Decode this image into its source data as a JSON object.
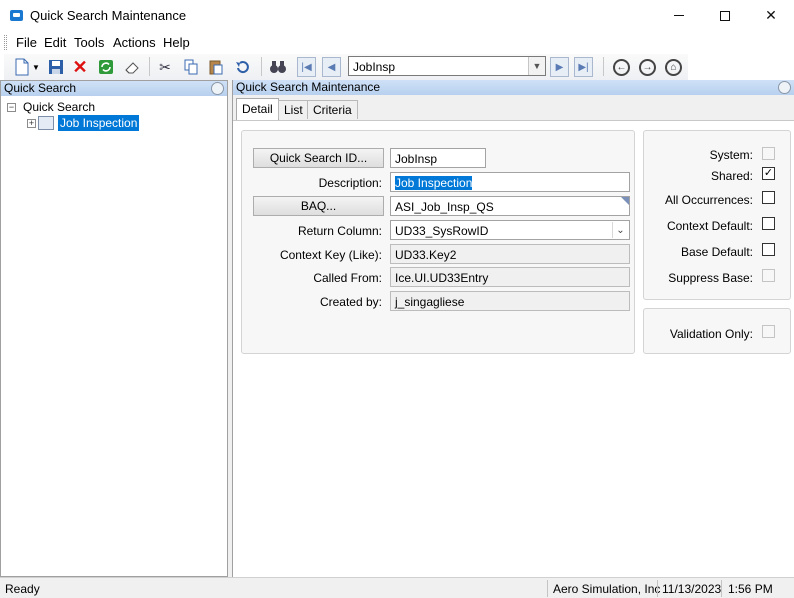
{
  "window": {
    "title": "Quick Search Maintenance"
  },
  "menu": [
    "File",
    "Edit",
    "Tools",
    "Actions",
    "Help"
  ],
  "toolbar": {
    "search_value": "JobInsp"
  },
  "tree": {
    "header": "Quick Search",
    "root_label": "Quick Search",
    "child_label": "Job Inspection"
  },
  "detail_panel": {
    "header": "Quick Search Maintenance",
    "tabs": [
      "Detail",
      "List",
      "Criteria"
    ]
  },
  "form": {
    "quick_search_id_button": "Quick Search ID...",
    "quick_search_id": "JobInsp",
    "description_label": "Description:",
    "description": "Job Inspection",
    "baq_button": "BAQ...",
    "baq": "ASI_Job_Insp_QS",
    "return_column_label": "Return Column:",
    "return_column": "UD33_SysRowID",
    "context_key_label": "Context Key (Like):",
    "context_key": "UD33.Key2",
    "called_from_label": "Called From:",
    "called_from": "Ice.UI.UD33Entry",
    "created_by_label": "Created by:",
    "created_by": "j_singagliese"
  },
  "flags": {
    "system_label": "System:",
    "shared_label": "Shared:",
    "all_occurrences_label": "All Occurrences:",
    "context_default_label": "Context Default:",
    "base_default_label": "Base Default:",
    "suppress_base_label": "Suppress Base:",
    "validation_only_label": "Validation Only:"
  },
  "status": {
    "state": "Ready",
    "company": "Aero Simulation, Inc",
    "date": "11/13/2023",
    "time": "1:56 PM"
  }
}
